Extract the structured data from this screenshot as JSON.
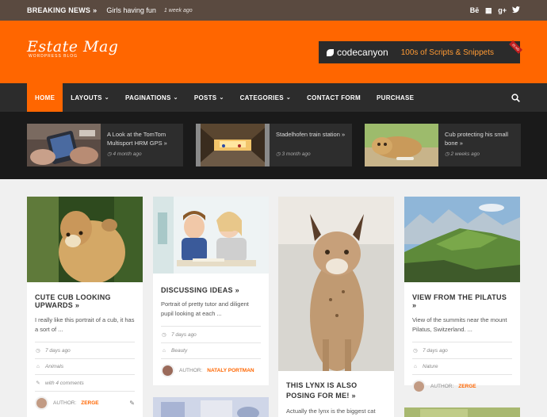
{
  "topbar": {
    "breaking_label": "BREAKING NEWS",
    "breaking_arrow": "»",
    "headline": "Girls having fun",
    "time": "1 week ago",
    "social": [
      "Bē",
      "▦",
      "g+",
      "🐦"
    ]
  },
  "logo": {
    "name": "Estate Mag",
    "tagline": "WORDPRESS BLOG"
  },
  "banner": {
    "brand": "codecanyon",
    "offer": "100s of Scripts & Snippets",
    "ribbon": "25 HD"
  },
  "nav": {
    "items": [
      {
        "label": "HOME",
        "caret": ""
      },
      {
        "label": "LAYOUTS",
        "caret": "⌄"
      },
      {
        "label": "PAGINATIONS",
        "caret": "⌄"
      },
      {
        "label": "POSTS",
        "caret": "⌄"
      },
      {
        "label": "CATEGORIES",
        "caret": "⌄"
      },
      {
        "label": "CONTACT FORM",
        "caret": ""
      },
      {
        "label": "PURCHASE",
        "caret": ""
      }
    ],
    "search_icon": "search-icon"
  },
  "featured": [
    {
      "title": "A Look at the TomTom Multisport HRM GPS »",
      "time": "4 month ago"
    },
    {
      "title": "Stadelhofen train station »",
      "time": "3 month ago"
    },
    {
      "title": "Cub protecting his small bone »",
      "time": "2 weeks ago"
    }
  ],
  "posts": [
    {
      "title": "CUTE CUB LOOKING UPWARDS »",
      "excerpt": "I really like this portrait of a cub, it has a sort of ...",
      "time": "7 days ago",
      "category": "Animals",
      "comments": "with 4 comments",
      "author_label": "AUTHOR:",
      "author": "ZERGE"
    },
    {
      "title": "DISCUSSING IDEAS »",
      "excerpt": "Portrait of pretty tutor and diligent pupil looking at each ...",
      "time": "7 days ago",
      "category": "Beauty",
      "author_label": "AUTHOR:",
      "author": "NATALY PORTMAN"
    },
    {
      "title": "THIS LYNX IS ALSO POSING FOR ME! »",
      "excerpt": "Actually the lynx is the biggest cat"
    },
    {
      "title": "VIEW FROM THE PILATUS »",
      "excerpt": "View of the summits near the mount Pilatus, Switzerland. ...",
      "time": "7 days ago",
      "category": "Nature",
      "author_label": "AUTHOR:",
      "author": "ZERGE"
    }
  ]
}
